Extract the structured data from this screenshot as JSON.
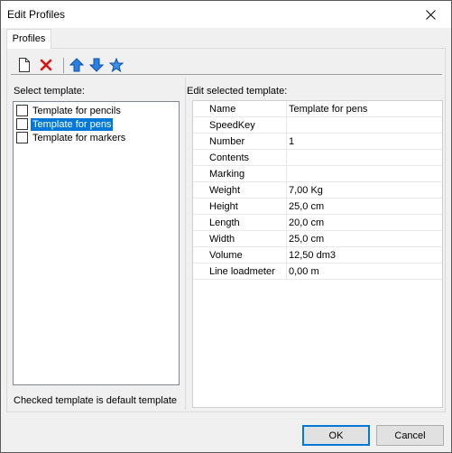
{
  "window": {
    "title": "Edit Profiles"
  },
  "tabs": [
    {
      "label": "Profiles"
    }
  ],
  "toolbar": {
    "buttons": [
      {
        "name": "new-icon"
      },
      {
        "name": "delete-icon"
      },
      {
        "name": "move-up-icon"
      },
      {
        "name": "move-down-icon"
      },
      {
        "name": "favorite-icon"
      }
    ]
  },
  "left": {
    "header": "Select template:",
    "items": [
      {
        "label": "Template for pencils",
        "checked": false,
        "selected": false
      },
      {
        "label": "Template for pens",
        "checked": false,
        "selected": true
      },
      {
        "label": "Template for markers",
        "checked": false,
        "selected": false
      }
    ],
    "footer": "Checked template is default template"
  },
  "right": {
    "header": "Edit selected template:",
    "properties": [
      {
        "name": "Name",
        "value": "Template for pens"
      },
      {
        "name": "SpeedKey",
        "value": ""
      },
      {
        "name": "Number",
        "value": "1"
      },
      {
        "name": "Contents",
        "value": ""
      },
      {
        "name": "Marking",
        "value": ""
      },
      {
        "name": "Weight",
        "value": "7,00 Kg"
      },
      {
        "name": "Height",
        "value": "25,0 cm"
      },
      {
        "name": "Length",
        "value": "20,0 cm"
      },
      {
        "name": "Width",
        "value": "25,0 cm"
      },
      {
        "name": "Volume",
        "value": "12,50 dm3"
      },
      {
        "name": "Line loadmeter",
        "value": "0,00 m"
      }
    ]
  },
  "buttons": {
    "ok": "OK",
    "cancel": "Cancel"
  },
  "colors": {
    "selection": "#0078d7",
    "toolbar_blue": "#2a7fe0",
    "delete_red": "#d11"
  }
}
